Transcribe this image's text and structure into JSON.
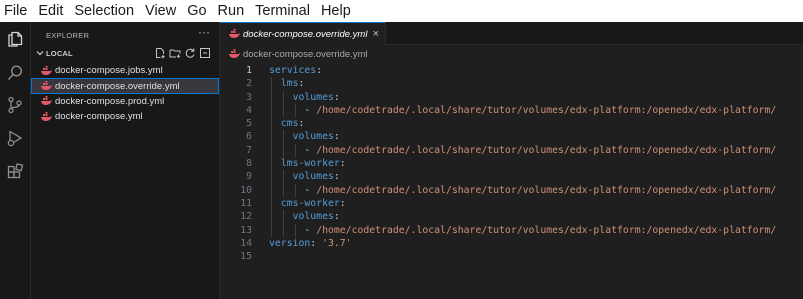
{
  "menu": [
    "File",
    "Edit",
    "Selection",
    "View",
    "Go",
    "Run",
    "Terminal",
    "Help"
  ],
  "activity_bar": [
    "explorer-icon",
    "search-icon",
    "source-control-icon",
    "run-debug-icon",
    "extensions-icon"
  ],
  "sidebar": {
    "title": "EXPLORER",
    "more": "···",
    "section": "LOCAL",
    "section_actions": [
      "new-file-icon",
      "new-folder-icon",
      "refresh-icon",
      "collapse-all-icon"
    ],
    "files": [
      {
        "label": "docker-compose.jobs.yml",
        "selected": false
      },
      {
        "label": "docker-compose.override.yml",
        "selected": true
      },
      {
        "label": "docker-compose.prod.yml",
        "selected": false
      },
      {
        "label": "docker-compose.yml",
        "selected": false
      }
    ]
  },
  "editor": {
    "tab": {
      "label": "docker-compose.override.yml",
      "close": "×"
    },
    "breadcrumb": "docker-compose.override.yml",
    "active_line": 1,
    "lines": [
      {
        "n": "1",
        "tokens": [
          {
            "t": "services",
            "c": "k"
          },
          {
            "t": ":",
            "c": "p"
          }
        ]
      },
      {
        "n": "2",
        "tokens": [
          {
            "t": "  lms",
            "c": "k"
          },
          {
            "t": ":",
            "c": "p"
          }
        ]
      },
      {
        "n": "3",
        "tokens": [
          {
            "t": "    volumes",
            "c": "k"
          },
          {
            "t": ":",
            "c": "p"
          }
        ]
      },
      {
        "n": "4",
        "tokens": [
          {
            "t": "      - ",
            "c": "p"
          },
          {
            "t": "/home/codetrade/.local/share/tutor/volumes/edx-platform:/openedx/edx-platform/",
            "c": "s"
          }
        ]
      },
      {
        "n": "5",
        "tokens": [
          {
            "t": "  cms",
            "c": "k"
          },
          {
            "t": ":",
            "c": "p"
          }
        ]
      },
      {
        "n": "6",
        "tokens": [
          {
            "t": "    volumes",
            "c": "k"
          },
          {
            "t": ":",
            "c": "p"
          }
        ]
      },
      {
        "n": "7",
        "tokens": [
          {
            "t": "      - ",
            "c": "p"
          },
          {
            "t": "/home/codetrade/.local/share/tutor/volumes/edx-platform:/openedx/edx-platform/",
            "c": "s"
          }
        ]
      },
      {
        "n": "8",
        "tokens": [
          {
            "t": "  lms-worker",
            "c": "k"
          },
          {
            "t": ":",
            "c": "p"
          }
        ]
      },
      {
        "n": "9",
        "tokens": [
          {
            "t": "    volumes",
            "c": "k"
          },
          {
            "t": ":",
            "c": "p"
          }
        ]
      },
      {
        "n": "10",
        "tokens": [
          {
            "t": "      - ",
            "c": "p"
          },
          {
            "t": "/home/codetrade/.local/share/tutor/volumes/edx-platform:/openedx/edx-platform/",
            "c": "s"
          }
        ]
      },
      {
        "n": "11",
        "tokens": [
          {
            "t": "  cms-worker",
            "c": "k"
          },
          {
            "t": ":",
            "c": "p"
          }
        ]
      },
      {
        "n": "12",
        "tokens": [
          {
            "t": "    volumes",
            "c": "k"
          },
          {
            "t": ":",
            "c": "p"
          }
        ]
      },
      {
        "n": "13",
        "tokens": [
          {
            "t": "      - ",
            "c": "p"
          },
          {
            "t": "/home/codetrade/.local/share/tutor/volumes/edx-platform:/openedx/edx-platform/",
            "c": "s"
          }
        ]
      },
      {
        "n": "14",
        "tokens": [
          {
            "t": "version",
            "c": "k"
          },
          {
            "t": ": ",
            "c": "p"
          },
          {
            "t": "'3.7'",
            "c": "s"
          }
        ]
      },
      {
        "n": "15",
        "tokens": []
      }
    ]
  },
  "colors": {
    "accent": "#0078d4",
    "key": "#569cd6",
    "string": "#ce9178",
    "docker_file_icon": "#e4596a"
  }
}
